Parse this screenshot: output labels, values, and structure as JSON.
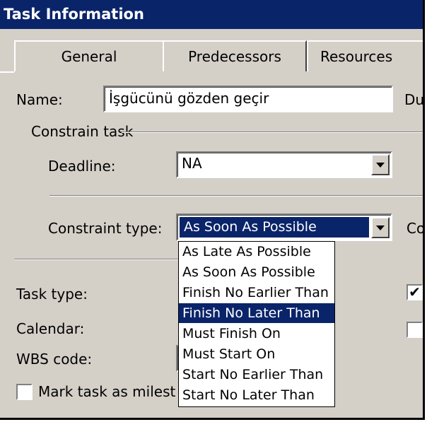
{
  "dialog": {
    "title": "Task Information"
  },
  "tabs": [
    {
      "label": "General"
    },
    {
      "label": "Predecessors"
    },
    {
      "label": "Resources"
    }
  ],
  "name_field": {
    "label": "Name:",
    "value": "İşgücünü gözden geçir",
    "right_label_partial": "Du"
  },
  "constrain_group": {
    "label": "Constrain task"
  },
  "deadline": {
    "label": "Deadline:",
    "value": "NA"
  },
  "constraint_type": {
    "label": "Constraint type:",
    "value": "As Soon As Possible",
    "right_label_partial": "Co"
  },
  "task_type": {
    "label": "Task type:"
  },
  "calendar": {
    "label": "Calendar:"
  },
  "wbs": {
    "label": "WBS code:"
  },
  "milestone": {
    "label": "Mark task as milest",
    "checked": false
  },
  "right_checkboxes": [
    {
      "checked": true
    },
    {
      "checked": false
    }
  ],
  "dropdown_options": [
    {
      "label": "As Late As Possible",
      "selected": false
    },
    {
      "label": "As Soon As Possible",
      "selected": false
    },
    {
      "label": "Finish No Earlier Than",
      "selected": false
    },
    {
      "label": "Finish No Later Than",
      "selected": true
    },
    {
      "label": "Must Finish On",
      "selected": false
    },
    {
      "label": "Must Start On",
      "selected": false
    },
    {
      "label": "Start No Earlier Than",
      "selected": false
    },
    {
      "label": "Start No Later Than",
      "selected": false
    }
  ],
  "colors": {
    "title_bar": "#0a246a",
    "dialog_face": "#d4d0c8",
    "highlight": "#0a246a"
  }
}
